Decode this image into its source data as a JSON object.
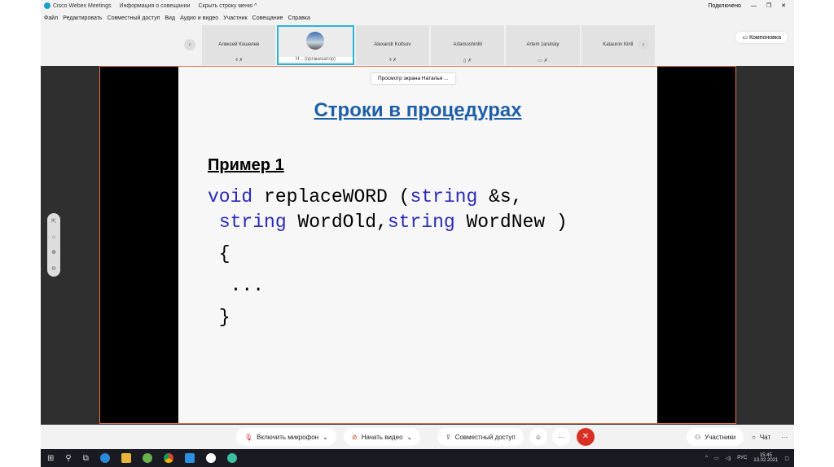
{
  "titlebar": {
    "app": "Cisco Webex Meetings",
    "info": "Информация о совещании",
    "hide_menu": "Скрыть строку меню ^",
    "status": "Подключено",
    "min": "—",
    "max": "❐",
    "close": "✕"
  },
  "menu": [
    "Файл",
    "Редактировать",
    "Совместный доступ",
    "Вид",
    "Аудио и видео",
    "Участник",
    "Совещание",
    "Справка"
  ],
  "participants": [
    {
      "name": "Алексей Кошелев",
      "status": "⌽ ✗"
    },
    {
      "name": "",
      "status": "Н... (организатор)"
    },
    {
      "name": "Alexandr Koltsov",
      "status": "⌽ ✗"
    },
    {
      "name": "ArtamoshinM",
      "status": "▯ ✗"
    },
    {
      "name": "Artem zarutsky",
      "status": "▭ ✗"
    },
    {
      "name": "Kataurov Kirill",
      "status": ""
    }
  ],
  "nav": {
    "prev": "‹",
    "next": "›"
  },
  "layout_label": "Компоновка",
  "viewing": "Просмотр экрана Наталья ...",
  "slide": {
    "title": "Строки в процедурах",
    "example": "Пример 1",
    "code": [
      [
        "void",
        " replaceWORD (",
        "string",
        " &s,"
      ],
      [
        " ",
        "string",
        " WordOld,",
        "string",
        " WordNew )"
      ],
      [
        " {"
      ],
      [
        "  ..."
      ],
      [
        " }"
      ]
    ]
  },
  "zoom_controls": [
    "⇱",
    "⌂",
    "⊕",
    "⊖"
  ],
  "bottom": {
    "mic": "Включить микрофон",
    "video": "Начать видео",
    "share": "Совместный доступ",
    "emoji": "☺",
    "more": "···",
    "end": "✕",
    "participants": "Участники",
    "chat": "Чат",
    "more2": "···"
  },
  "taskbar": {
    "lang": "РУС",
    "time": "15:45",
    "date": "13.02.2021"
  }
}
